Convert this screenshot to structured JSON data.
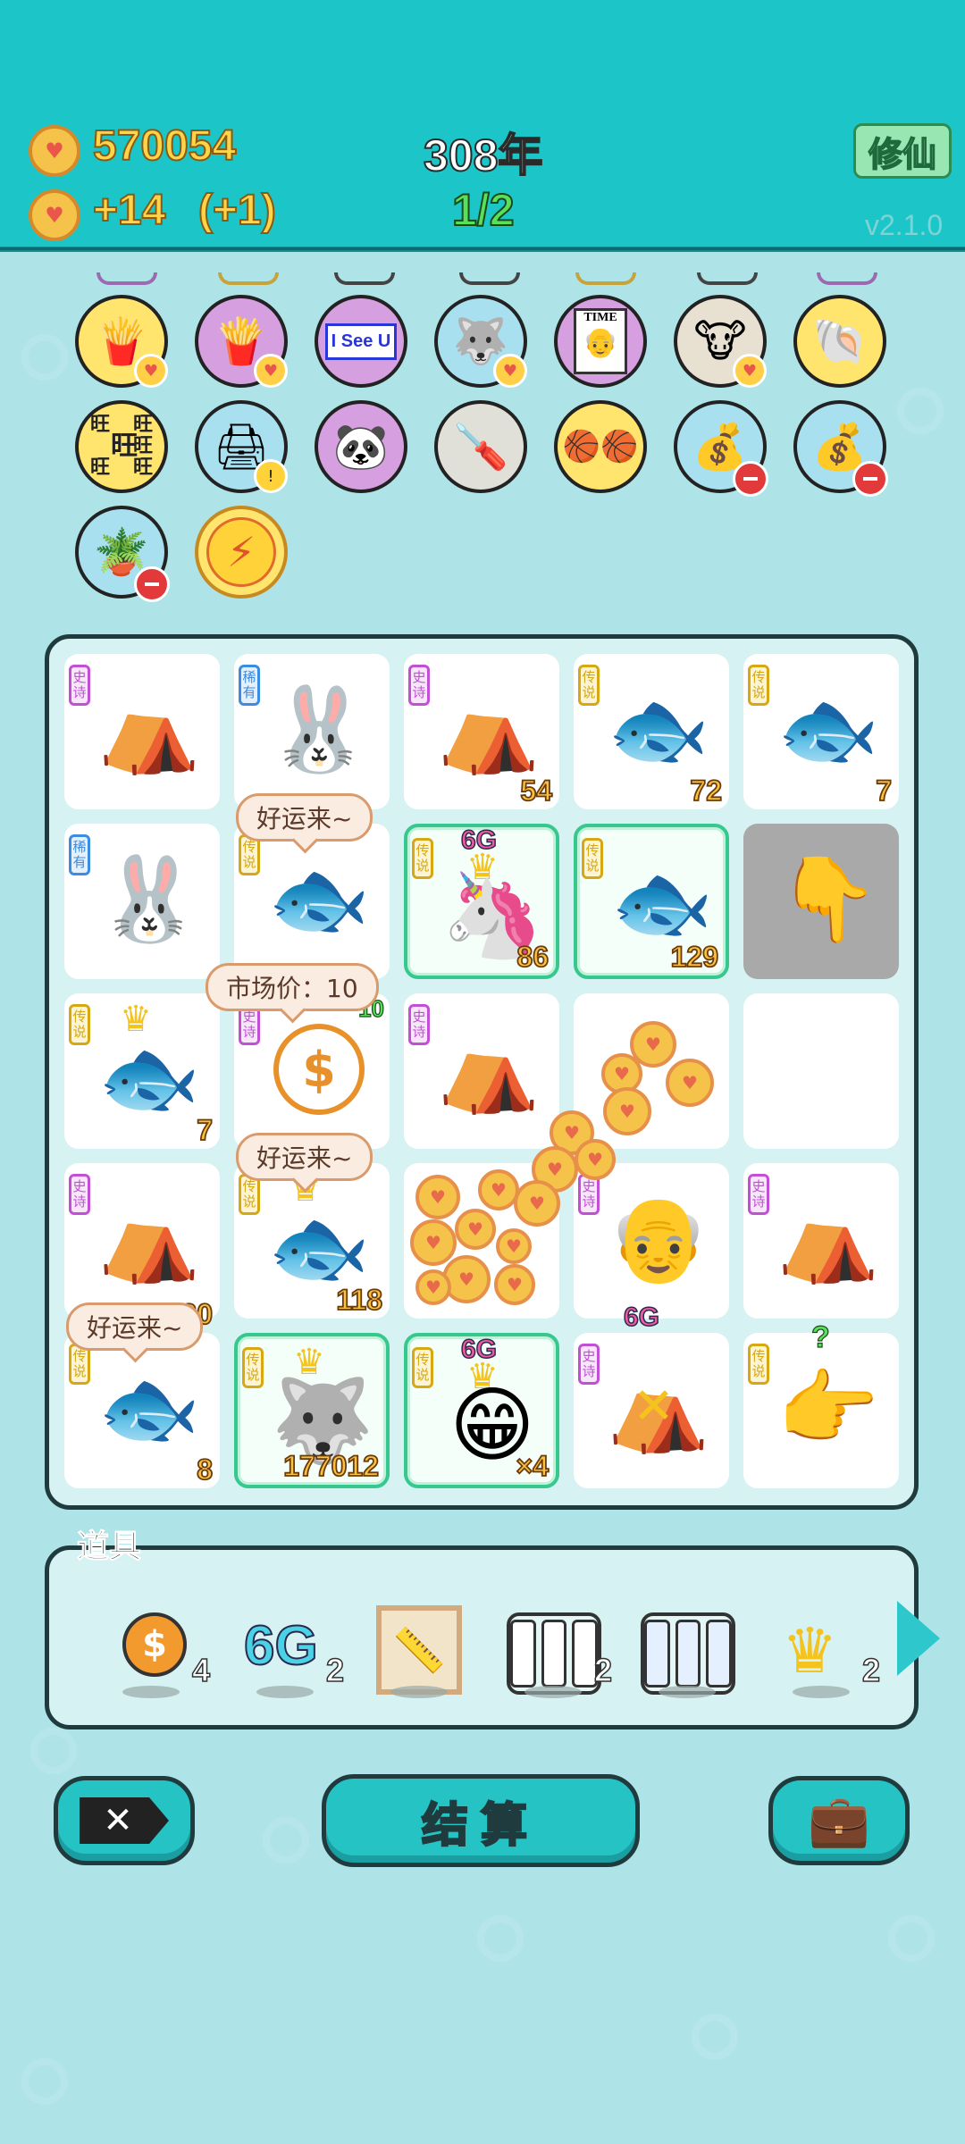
{
  "header": {
    "coins": "570054",
    "income": "+14",
    "bonus": "(+1)",
    "year": "308年",
    "round": "1/2",
    "mode_button": "修仙",
    "version": "v2.1.0"
  },
  "owned_items": [
    {
      "icon": "french-fries-icon",
      "bg": "#ffe46e"
    },
    {
      "icon": "french-fries-icon",
      "bg": "#d6a0e0"
    },
    {
      "icon": "i-see-u-icon",
      "bg": "#ffffff",
      "text": "I See U"
    },
    {
      "icon": "husky-dog-icon",
      "bg": "#a8e0ef"
    },
    {
      "icon": "time-magazine-icon",
      "bg": "#d6a0e0",
      "text": "TIME"
    },
    {
      "icon": "cow-pair-icon",
      "bg": "#e8e0d0"
    },
    {
      "icon": "shell-icon",
      "bg": "#ffe46e"
    },
    {
      "icon": "wang-characters-icon",
      "bg": "#ffe46e",
      "text": "旺"
    },
    {
      "icon": "printer-icon",
      "bg": "#a8e0ef"
    },
    {
      "icon": "panda-icon",
      "bg": "#d6a0e0"
    },
    {
      "icon": "screwdriver-icon",
      "bg": "#e0e0d8"
    },
    {
      "icon": "basketballs-icon",
      "bg": "#ffe46e"
    },
    {
      "icon": "money-bag-icon",
      "bg": "#a8e0ef"
    },
    {
      "icon": "money-bag-icon",
      "bg": "#a8e0ef"
    },
    {
      "icon": "flower-pot-icon",
      "bg": "#a8e0ef"
    },
    {
      "icon": "lightning-icon",
      "bg": "#ffe46e"
    }
  ],
  "rarity_labels": {
    "epic": "史诗",
    "rare": "稀有",
    "legend": "传说"
  },
  "board": {
    "cells": [
      {
        "rarity": "史诗",
        "symbol": "rabbit-house-icon",
        "value": ""
      },
      {
        "rarity": "稀有",
        "symbol": "rabbit-icon",
        "value": ""
      },
      {
        "rarity": "史诗",
        "symbol": "rabbit-house-icon",
        "value": "54"
      },
      {
        "rarity": "传说",
        "symbol": "koi-fish-icon",
        "value": "72"
      },
      {
        "rarity": "传说",
        "symbol": "koi-fish-icon",
        "value": "7"
      },
      {
        "rarity": "稀有",
        "symbol": "rabbit-icon",
        "value": ""
      },
      {
        "rarity": "传说",
        "symbol": "koi-fish-icon",
        "value": ""
      },
      {
        "rarity": "传说",
        "symbol": "unicorn-icon",
        "value": "86",
        "tag": "6G"
      },
      {
        "rarity": "传说",
        "symbol": "koi-fish-icon",
        "value": "129"
      },
      {
        "rarity": "",
        "symbol": "pointing-hand-icon",
        "value": ""
      },
      {
        "rarity": "传说",
        "symbol": "koi-fish-icon",
        "value": "7"
      },
      {
        "rarity": "史诗",
        "symbol": "coin-cycle-icon",
        "value": "10"
      },
      {
        "rarity": "史诗",
        "symbol": "rabbit-house-icon",
        "value": ""
      },
      {
        "rarity": "",
        "symbol": "",
        "value": ""
      },
      {
        "rarity": "",
        "symbol": "",
        "value": ""
      },
      {
        "rarity": "史诗",
        "symbol": "rabbit-house-icon",
        "value": "220"
      },
      {
        "rarity": "传说",
        "symbol": "koi-fish-icon",
        "value": "118"
      },
      {
        "rarity": "",
        "symbol": "",
        "value": ""
      },
      {
        "rarity": "史诗",
        "symbol": "old-man-face-icon",
        "value": ""
      },
      {
        "rarity": "史诗",
        "symbol": "rabbit-house-icon",
        "value": ""
      },
      {
        "rarity": "传说",
        "symbol": "koi-fish-icon",
        "value": "8"
      },
      {
        "rarity": "传说",
        "symbol": "husky-king-icon",
        "value": "177012"
      },
      {
        "rarity": "传说",
        "symbol": "grinning-old-man-icon",
        "value": "×4",
        "tag": "6G"
      },
      {
        "rarity": "史诗",
        "symbol": "rabbit-house-icon",
        "value": "",
        "tag": "6G"
      },
      {
        "rarity": "传说",
        "symbol": "pointing-hand-icon",
        "value": "",
        "tag": "?"
      }
    ],
    "bubbles": {
      "lucky_1": "好运来~",
      "market_price": "市场价：10",
      "lucky_2": "好运来~",
      "lucky_3": "好运来~"
    }
  },
  "props": {
    "title": "道具",
    "items": [
      {
        "icon": "coin-icon",
        "count": "4"
      },
      {
        "icon": "6g-icon",
        "label": "6G",
        "count": "2"
      },
      {
        "icon": "ruler-frame-icon",
        "count": ""
      },
      {
        "icon": "three-slots-icon",
        "count": "2"
      },
      {
        "icon": "three-rare-slots-icon",
        "count": ""
      },
      {
        "icon": "crown-icon",
        "count": "2"
      }
    ]
  },
  "buttons": {
    "settle": "结算"
  },
  "colors": {
    "header": "#1cc6c8",
    "background": "#aee3e8",
    "button": "#26c3c4",
    "gold_text": "#ffd34a"
  }
}
